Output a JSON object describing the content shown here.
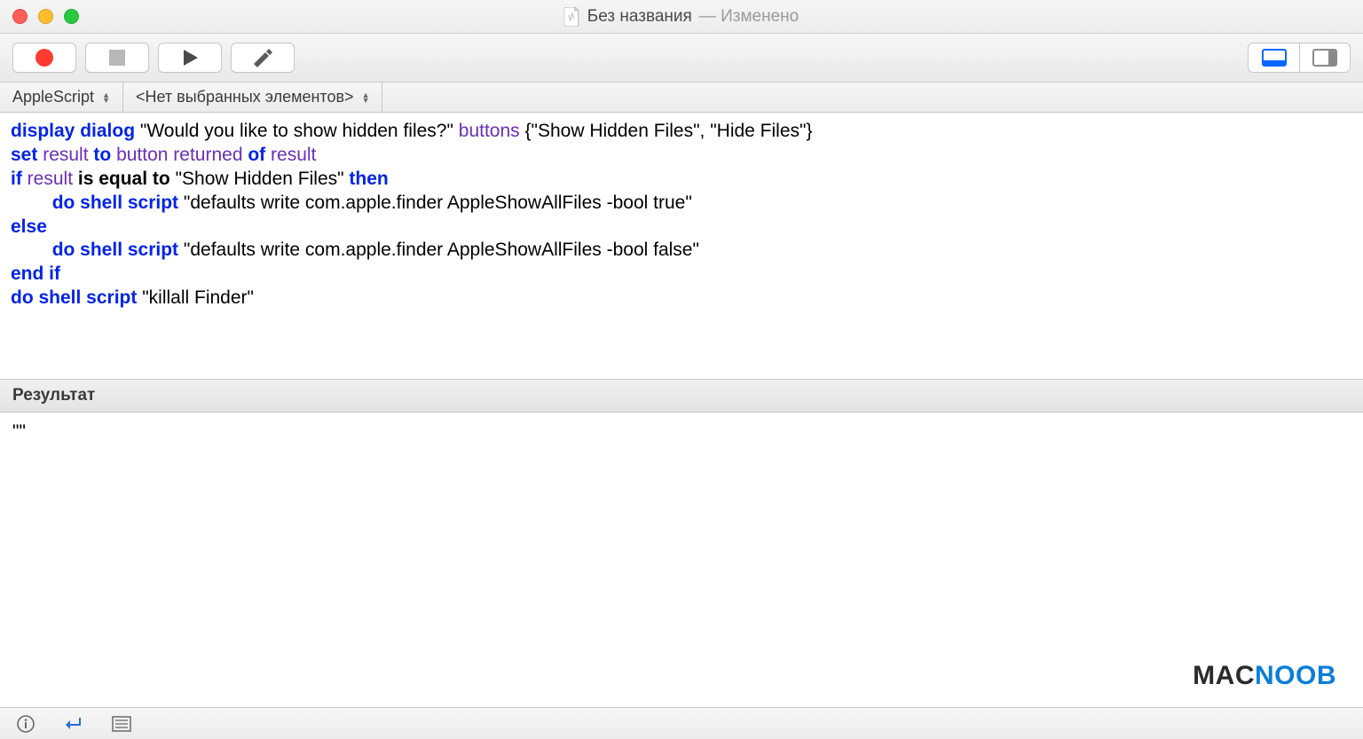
{
  "window": {
    "title": "Без названия",
    "status_suffix": "— Изменено"
  },
  "navbar": {
    "language": "AppleScript",
    "path_placeholder": "<Нет выбранных элементов>"
  },
  "code": {
    "tokens": [
      {
        "t": "display dialog",
        "c": "kw-blue"
      },
      {
        "t": " ",
        "c": ""
      },
      {
        "t": "\"Would you like to show hidden files?\"",
        "c": "str"
      },
      {
        "t": " ",
        "c": ""
      },
      {
        "t": "buttons",
        "c": "kw-purple"
      },
      {
        "t": " ",
        "c": ""
      },
      {
        "t": "{\"Show Hidden Files\", \"Hide Files\"}",
        "c": "str"
      },
      {
        "t": "\n",
        "c": ""
      },
      {
        "t": "set",
        "c": "kw-blue"
      },
      {
        "t": " ",
        "c": ""
      },
      {
        "t": "result",
        "c": "kw-purple"
      },
      {
        "t": " ",
        "c": ""
      },
      {
        "t": "to",
        "c": "kw-blue"
      },
      {
        "t": " ",
        "c": ""
      },
      {
        "t": "button returned",
        "c": "kw-purple"
      },
      {
        "t": " ",
        "c": ""
      },
      {
        "t": "of",
        "c": "kw-blue"
      },
      {
        "t": " ",
        "c": ""
      },
      {
        "t": "result",
        "c": "kw-purple"
      },
      {
        "t": "\n",
        "c": ""
      },
      {
        "t": "if",
        "c": "kw-blue"
      },
      {
        "t": " ",
        "c": ""
      },
      {
        "t": "result",
        "c": "kw-purple"
      },
      {
        "t": " ",
        "c": ""
      },
      {
        "t": "is equal to",
        "c": "kw-bold"
      },
      {
        "t": " ",
        "c": ""
      },
      {
        "t": "\"Show Hidden Files\"",
        "c": "str"
      },
      {
        "t": " ",
        "c": ""
      },
      {
        "t": "then",
        "c": "kw-blue"
      },
      {
        "t": "\n\t",
        "c": ""
      },
      {
        "t": "do shell script",
        "c": "kw-blue"
      },
      {
        "t": " ",
        "c": ""
      },
      {
        "t": "\"defaults write com.apple.finder AppleShowAllFiles -bool true\"",
        "c": "str"
      },
      {
        "t": "\n",
        "c": ""
      },
      {
        "t": "else",
        "c": "kw-blue"
      },
      {
        "t": "\n\t",
        "c": ""
      },
      {
        "t": "do shell script",
        "c": "kw-blue"
      },
      {
        "t": " ",
        "c": ""
      },
      {
        "t": "\"defaults write com.apple.finder AppleShowAllFiles -bool false\"",
        "c": "str"
      },
      {
        "t": "\n",
        "c": ""
      },
      {
        "t": "end if",
        "c": "kw-blue"
      },
      {
        "t": "\n",
        "c": ""
      },
      {
        "t": "do shell script",
        "c": "kw-blue"
      },
      {
        "t": " ",
        "c": ""
      },
      {
        "t": "\"killall Finder\"",
        "c": "str"
      }
    ]
  },
  "results": {
    "header": "Результат",
    "output": "\"\""
  },
  "watermark": {
    "part1": "MAC",
    "part2": "NOOB"
  }
}
